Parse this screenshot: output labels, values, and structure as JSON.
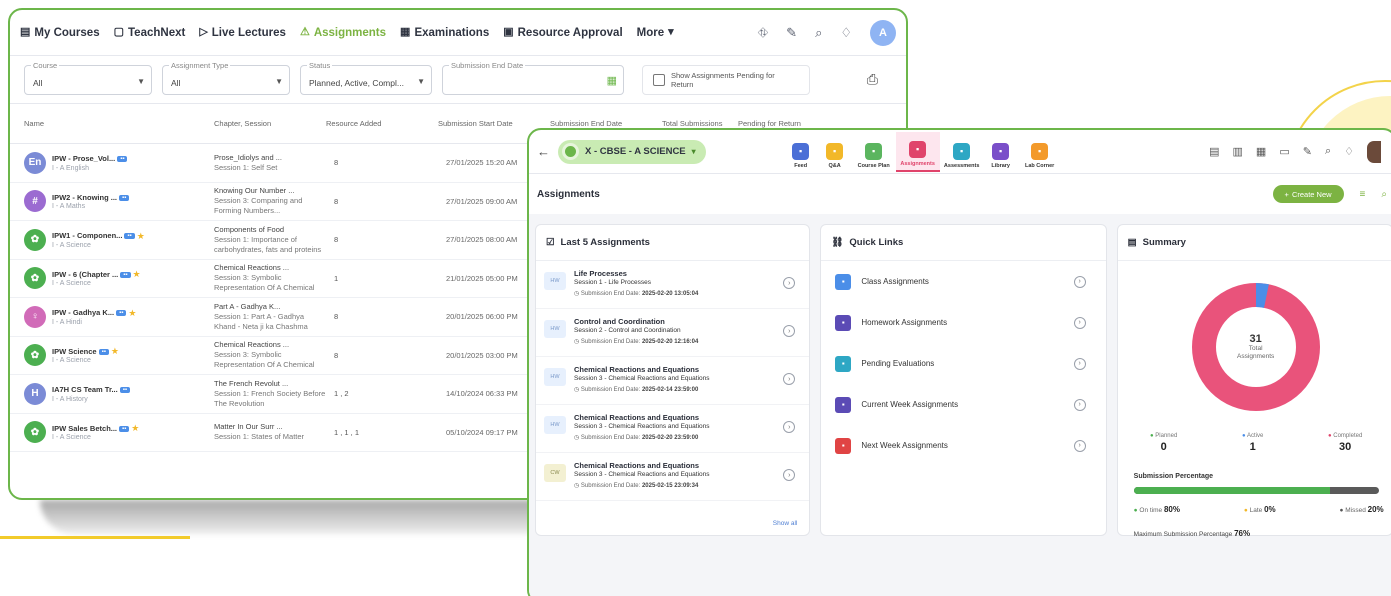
{
  "colors": {
    "accent": "#7cb342",
    "pink": "#e0446b",
    "blue": "#4b8ee8",
    "frame": "#6cb64a"
  },
  "w1": {
    "nav": [
      {
        "label": "My Courses",
        "icon": "book-icon"
      },
      {
        "label": "TeachNext",
        "icon": "monitor-icon"
      },
      {
        "label": "Live Lectures",
        "icon": "video-icon"
      },
      {
        "label": "Assignments",
        "icon": "assignment-icon",
        "active": true
      },
      {
        "label": "Examinations",
        "icon": "exam-icon"
      },
      {
        "label": "Resource Approval",
        "icon": "approval-icon"
      },
      {
        "label": "More",
        "icon": "chevron-down-icon"
      }
    ],
    "avatar_initial": "A",
    "filters": {
      "course_label": "Course",
      "course_value": "All",
      "type_label": "Assignment Type",
      "type_value": "All",
      "status_label": "Status",
      "status_value": "Planned, Active, Compl...",
      "end_date_label": "Submission End Date",
      "pending_label": "Show Assignments Pending for Return"
    },
    "columns": [
      "Name",
      "Chapter, Session",
      "Resource Added",
      "Submission Start Date",
      "Submission End Date",
      "Total Submissions",
      "Pending for Return"
    ],
    "rows": [
      {
        "initial": "En",
        "color": "#7b8bd6",
        "name": "IPW - Prose_Vol...",
        "sub": "I - A English",
        "chap": "Prose_Idiolys and ...",
        "chap2": "Session 1: Self Set",
        "res": "8",
        "date": "27/01/2025 15:20 AM"
      },
      {
        "initial": "#",
        "color": "#9b6bd1",
        "name": "IPW2 - Knowing ...",
        "sub": "I - A Maths",
        "chap": "Knowing Our Number ...",
        "chap2": "Session 3: Comparing and Forming Numbers...",
        "res": "8",
        "date": "27/01/2025 09:00 AM"
      },
      {
        "initial": "✿",
        "color": "#4caf50",
        "name": "IPW1 - Componen...",
        "sub": "I - A Science",
        "chap": "Components of Food",
        "chap2": "Session 1: Importance of carbohydrates, fats and proteins",
        "res": "8",
        "date": "27/01/2025 08:00 AM"
      },
      {
        "initial": "✿",
        "color": "#4caf50",
        "name": "IPW - 6 (Chapter ...",
        "sub": "I - A Science",
        "chap": "Chemical Reactions ...",
        "chap2": "Session 3: Symbolic Representation Of A Chemical Reaction",
        "res": "1",
        "date": "21/01/2025 05:00 PM"
      },
      {
        "initial": "♀",
        "color": "#d16bb8",
        "name": "IPW - Gadhya K...",
        "sub": "I - A Hindi",
        "chap": "Part A - Gadhya K...",
        "chap2": "Session 1: Part A - Gadhya Khand - Neta ji ka Chashma",
        "res": "8",
        "date": "20/01/2025 06:00 PM"
      },
      {
        "initial": "✿",
        "color": "#4caf50",
        "name": "IPW Science",
        "sub": "I - A Science",
        "chap": "Chemical Reactions ...",
        "chap2": "Session 3: Symbolic Representation Of A Chemical Reaction",
        "res": "8",
        "date": "20/01/2025 03:00 PM"
      },
      {
        "initial": "H",
        "color": "#7b8bd6",
        "name": "IA7H CS Team Tr...",
        "sub": "I - A History",
        "chap": "The French Revolut ...",
        "chap2": "Session 1: French Society Before The Revolution",
        "res": "1 , 2",
        "date": "14/10/2024 06:33 PM"
      },
      {
        "initial": "✿",
        "color": "#4caf50",
        "name": "IPW Sales Betch...",
        "sub": "I - A Science",
        "chap": "Matter In Our Surr ...",
        "chap2": "Session 1: States of Matter",
        "res": "1 , 1 , 1",
        "date": "05/10/2024 09:17 PM"
      }
    ]
  },
  "w2": {
    "class_label": "X - CBSE - A  SCIENCE",
    "tabs": [
      {
        "label": "Feed",
        "color": "#4b6fd6"
      },
      {
        "label": "Q&A",
        "color": "#f2b829"
      },
      {
        "label": "Course Plan",
        "color": "#5bb55f"
      },
      {
        "label": "Assignments",
        "color": "#e0446b",
        "active": true
      },
      {
        "label": "Assessments",
        "color": "#2ea7c4"
      },
      {
        "label": "Library",
        "color": "#7a4fc9"
      },
      {
        "label": "Lab Corner",
        "color": "#f39a2b"
      }
    ],
    "title": "Assignments",
    "create_label": "Create New",
    "last5": {
      "title": "Last 5 Assignments",
      "items": [
        {
          "badge": "HW",
          "title": "Life Processes",
          "session": "Session 1 - Life Processes",
          "date_label": "Submission End Date:",
          "date": "2025-02-20 13:05:04"
        },
        {
          "badge": "HW",
          "title": "Control and Coordination",
          "session": "Session 2 - Control and Coordination",
          "date_label": "Submission End Date:",
          "date": "2025-02-20 12:16:04"
        },
        {
          "badge": "HW",
          "title": "Chemical Reactions and Equations",
          "session": "Session 3 - Chemical Reactions and Equations",
          "date_label": "Submission End Date:",
          "date": "2025-02-14 23:59:00"
        },
        {
          "badge": "HW",
          "title": "Chemical Reactions and Equations",
          "session": "Session 3 - Chemical Reactions and Equations",
          "date_label": "Submission End Date:",
          "date": "2025-02-20 23:59:00"
        },
        {
          "badge": "CW",
          "title": "Chemical Reactions and Equations",
          "session": "Session 3 - Chemical Reactions and Equations",
          "date_label": "Submission End Date:",
          "date": "2025-02-15 23:09:34"
        }
      ],
      "show_all": "Show all"
    },
    "quick_links": {
      "title": "Quick Links",
      "items": [
        {
          "label": "Class Assignments",
          "color": "#4b8ee8"
        },
        {
          "label": "Homework Assignments",
          "color": "#5b4bb5"
        },
        {
          "label": "Pending Evaluations",
          "color": "#2ea7c4"
        },
        {
          "label": "Current Week Assignments",
          "color": "#5b4bb5"
        },
        {
          "label": "Next Week Assignments",
          "color": "#e04444"
        }
      ]
    },
    "summary": {
      "title": "Summary",
      "total": "31",
      "total_label": "Total Assignments",
      "planned_label": "Planned",
      "planned": "0",
      "active_label": "Active",
      "active": "1",
      "completed_label": "Completed",
      "completed": "30",
      "submission_label": "Submission Percentage",
      "ontime_label": "On time",
      "ontime": "80%",
      "late_label": "Late",
      "late": "0%",
      "missed_label": "Missed",
      "missed": "20%",
      "max_label": "Maximum Submission Percentage",
      "max": "76%",
      "ontime_fraction": 0.8
    }
  }
}
